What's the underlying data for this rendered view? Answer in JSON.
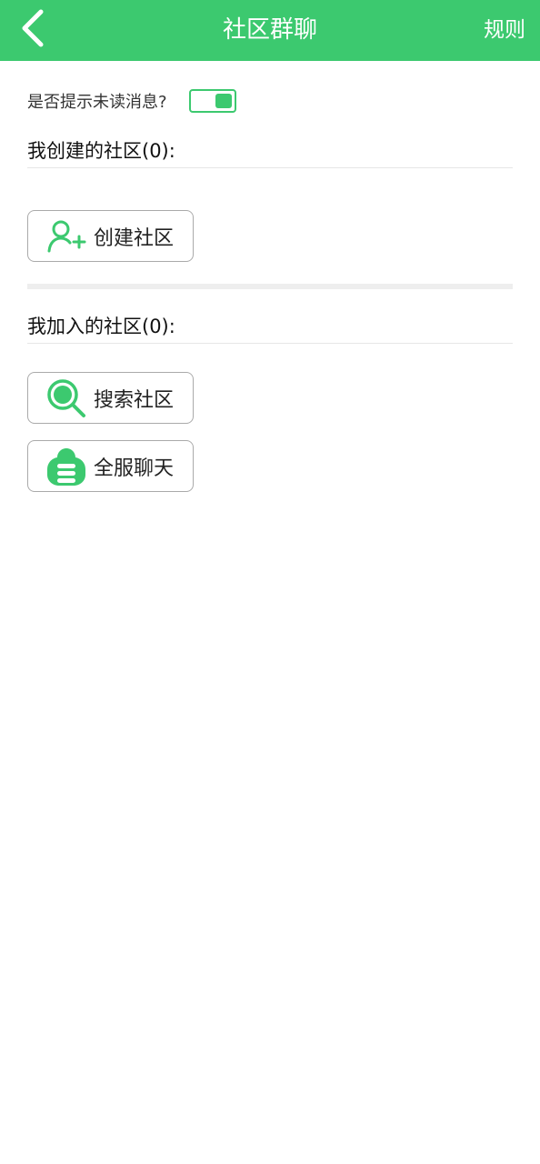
{
  "header": {
    "title": "社区群聊",
    "rules_label": "规则",
    "back_icon": "chevron-left-icon",
    "background_color": "#3cc96f"
  },
  "settings": {
    "unread_prompt_label": "是否提示未读消息?",
    "unread_prompt_enabled": true
  },
  "created_section": {
    "title": "我创建的社区(0):",
    "create_button_label": "创建社区",
    "create_icon": "add-user-icon"
  },
  "joined_section": {
    "title": "我加入的社区(0):",
    "search_button_label": "搜索社区",
    "search_icon": "search-icon",
    "global_chat_button_label": "全服聊天",
    "global_chat_icon": "cloud-chat-icon"
  },
  "colors": {
    "accent": "#3cc96f"
  }
}
